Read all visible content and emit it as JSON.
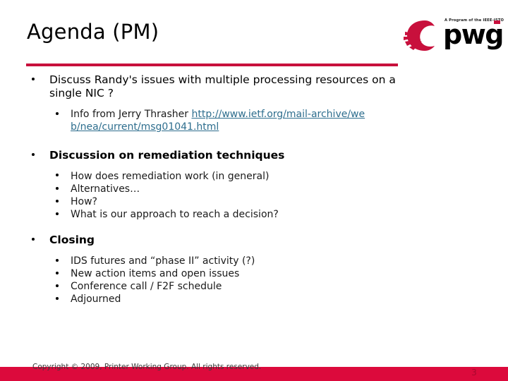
{
  "slide": {
    "title": "Agenda (PM)",
    "accent_color": "#C8103C",
    "footer_bar_color": "#DC0A3C",
    "link_color": "#2E6E8E"
  },
  "logo": {
    "name": "pwg-logo",
    "wordmark": "pwg",
    "tagline": "A Program of the IEEE-ISTO",
    "mark_color": "#C8103C"
  },
  "content": {
    "b1": {
      "text": "Discuss Randy's issues with multiple processing resources on a single NIC ?",
      "sub1_prefix": "Info from Jerry Thrasher ",
      "sub1_link": "http://www.ietf.org/mail-archive/web/nea/current/msg01041.html"
    },
    "b2": {
      "text": "Discussion on remediation techniques",
      "sub": [
        "How does remediation work (in general)",
        "Alternatives…",
        "How?",
        "What is our approach to reach a decision?"
      ]
    },
    "b3": {
      "text": "Closing",
      "sub": [
        "IDS futures and “phase II” activity (?)",
        "New action items and open issues",
        "Conference call / F2F schedule",
        "Adjourned"
      ]
    }
  },
  "footer": {
    "copyright": "Copyright © 2009, Printer Working Group. All rights reserved.",
    "page_number": "3"
  }
}
